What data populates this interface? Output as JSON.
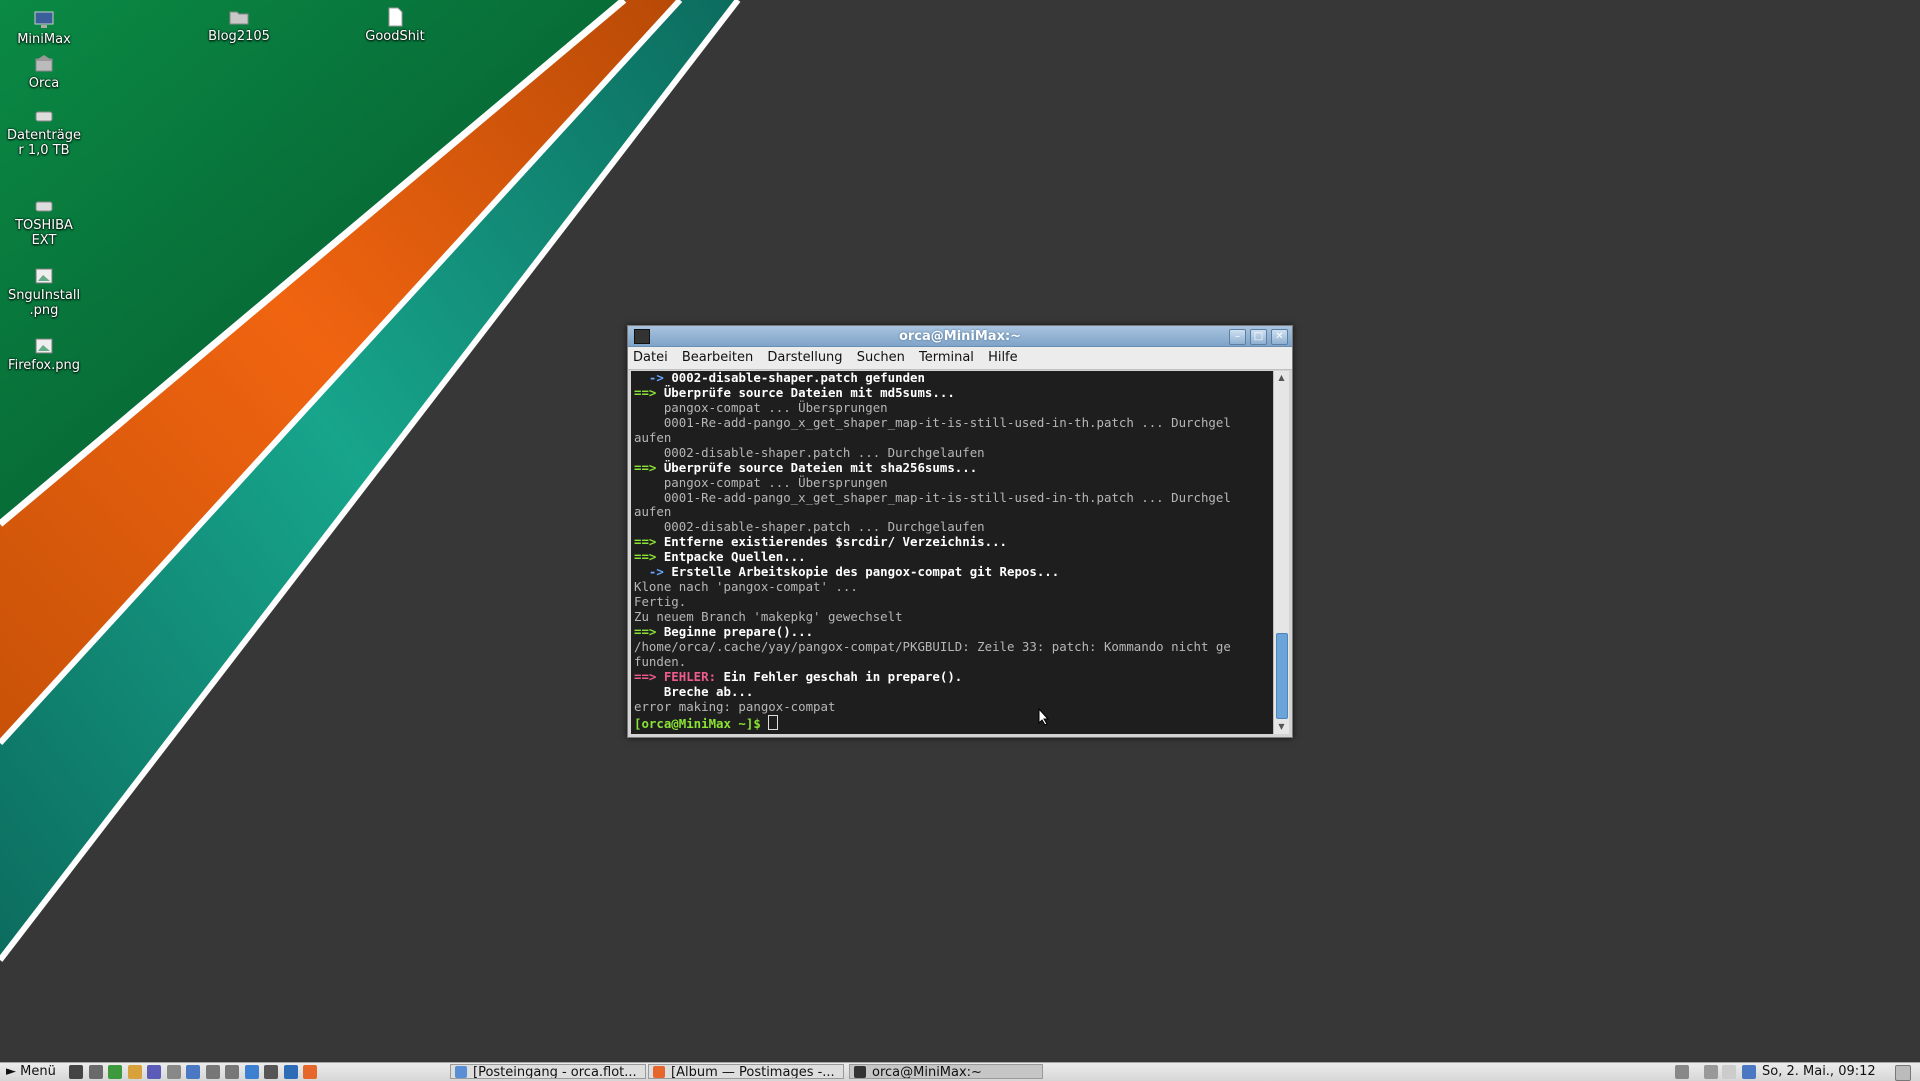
{
  "desktop": {
    "icons": [
      {
        "label": "MiniMax",
        "icon": "computer-icon"
      },
      {
        "label": "Orca",
        "icon": "home-folder-icon"
      },
      {
        "label": "Datenträger 1,0 TB",
        "icon": "drive-icon"
      },
      {
        "label": "TOSHIBA EXT",
        "icon": "drive-icon"
      },
      {
        "label": "SnguInstall.png",
        "icon": "image-file-icon"
      },
      {
        "label": "Firefox.png",
        "icon": "image-file-icon"
      },
      {
        "label": "Blog2105",
        "icon": "folder-icon"
      },
      {
        "label": "GoodShit",
        "icon": "document-icon"
      }
    ],
    "wallpaper_colors": {
      "background": "#373737",
      "green": "#0a7a3c",
      "orange": "#e8620e",
      "teal": "#159a84",
      "stripe": "#ffffff"
    }
  },
  "terminal": {
    "title": "orca@MiniMax:~",
    "menu": [
      "Datei",
      "Bearbeiten",
      "Darstellung",
      "Suchen",
      "Terminal",
      "Hilfe"
    ],
    "lines": [
      [
        {
          "t": "  -> ",
          "c": "blu"
        },
        {
          "t": "0002-disable-shaper.patch gefunden",
          "c": "b"
        }
      ],
      [
        {
          "t": "==> ",
          "c": "g"
        },
        {
          "t": "Überprüfe source Dateien mit md5sums...",
          "c": "b"
        }
      ],
      [
        {
          "t": "    pangox-compat ... Übersprungen",
          "c": ""
        }
      ],
      [
        {
          "t": "    0001-Re-add-pango_x_get_shaper_map-it-is-still-used-in-th.patch ... Durchgel",
          "c": ""
        }
      ],
      [
        {
          "t": "aufen",
          "c": ""
        }
      ],
      [
        {
          "t": "    0002-disable-shaper.patch ... Durchgelaufen",
          "c": ""
        }
      ],
      [
        {
          "t": "==> ",
          "c": "g"
        },
        {
          "t": "Überprüfe source Dateien mit sha256sums...",
          "c": "b"
        }
      ],
      [
        {
          "t": "    pangox-compat ... Übersprungen",
          "c": ""
        }
      ],
      [
        {
          "t": "    0001-Re-add-pango_x_get_shaper_map-it-is-still-used-in-th.patch ... Durchgel",
          "c": ""
        }
      ],
      [
        {
          "t": "aufen",
          "c": ""
        }
      ],
      [
        {
          "t": "    0002-disable-shaper.patch ... Durchgelaufen",
          "c": ""
        }
      ],
      [
        {
          "t": "==> ",
          "c": "g"
        },
        {
          "t": "Entferne existierendes $srcdir/ Verzeichnis...",
          "c": "b"
        }
      ],
      [
        {
          "t": "==> ",
          "c": "g"
        },
        {
          "t": "Entpacke Quellen...",
          "c": "b"
        }
      ],
      [
        {
          "t": "  -> ",
          "c": "blu"
        },
        {
          "t": "Erstelle Arbeitskopie des pangox-compat git Repos...",
          "c": "b"
        }
      ],
      [
        {
          "t": "Klone nach 'pangox-compat' ...",
          "c": ""
        }
      ],
      [
        {
          "t": "Fertig.",
          "c": ""
        }
      ],
      [
        {
          "t": "Zu neuem Branch 'makepkg' gewechselt",
          "c": ""
        }
      ],
      [
        {
          "t": "==> ",
          "c": "g"
        },
        {
          "t": "Beginne prepare()...",
          "c": "b"
        }
      ],
      [
        {
          "t": "/home/orca/.cache/yay/pangox-compat/PKGBUILD: Zeile 33: patch: Kommando nicht ge",
          "c": ""
        }
      ],
      [
        {
          "t": "funden.",
          "c": ""
        }
      ],
      [
        {
          "t": "==> ",
          "c": "r"
        },
        {
          "t": "FEHLER:",
          "c": "r"
        },
        {
          "t": " Ein Fehler geschah in prepare().",
          "c": "b"
        }
      ],
      [
        {
          "t": "    Breche ab...",
          "c": "b"
        }
      ],
      [
        {
          "t": "error making: pangox-compat",
          "c": ""
        }
      ],
      [
        {
          "t": "[orca@MiniMax ~]$ ",
          "c": "g"
        }
      ]
    ]
  },
  "taskbar": {
    "menu_label": "Menü",
    "launchers": [
      "terminal-icon",
      "files-icon",
      "network-icon",
      "editor-icon",
      "settings-icon",
      "archive-icon",
      "document-icon",
      "calculator-icon",
      "screenshot-icon",
      "browser-icon",
      "gimp-icon",
      "thunderbird-icon",
      "firefox-icon"
    ],
    "tasks": [
      {
        "label": "[Posteingang - orca.flot...",
        "icon": "mail-icon",
        "color": "#5a8fd6"
      },
      {
        "label": "[Album — Postimages -...",
        "icon": "firefox-icon",
        "color": "#e5672c"
      },
      {
        "label": "orca@MiniMax:~",
        "icon": "terminal-icon",
        "color": "#333333"
      }
    ],
    "clock": "So,  2. Mai., 09:12"
  }
}
